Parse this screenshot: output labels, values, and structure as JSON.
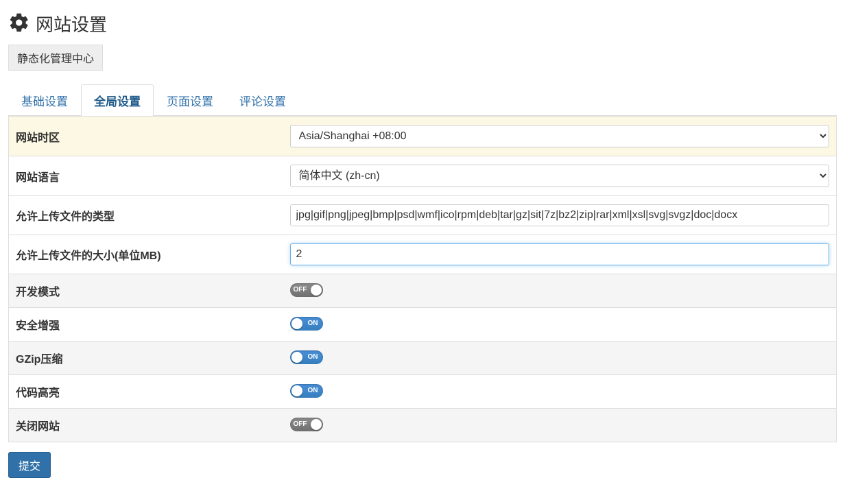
{
  "header": {
    "title": "网站设置",
    "subnav": "静态化管理中心"
  },
  "tabs": {
    "basic": "基础设置",
    "global": "全局设置",
    "page": "页面设置",
    "comment": "评论设置"
  },
  "rows": {
    "timezone": {
      "label": "网站时区",
      "value": "Asia/Shanghai +08:00"
    },
    "language": {
      "label": "网站语言",
      "value": "简体中文 (zh-cn)"
    },
    "upload_types": {
      "label": "允许上传文件的类型",
      "value": "jpg|gif|png|jpeg|bmp|psd|wmf|ico|rpm|deb|tar|gz|sit|7z|bz2|zip|rar|xml|xsl|svg|svgz|doc|docx"
    },
    "upload_size": {
      "label": "允许上传文件的大小(单位MB)",
      "value": "2"
    },
    "dev_mode": {
      "label": "开发模式",
      "state": "OFF"
    },
    "security": {
      "label": "安全增强",
      "state": "ON"
    },
    "gzip": {
      "label": "GZip压缩",
      "state": "ON"
    },
    "highlight": {
      "label": "代码高亮",
      "state": "ON"
    },
    "close_site": {
      "label": "关闭网站",
      "state": "OFF"
    }
  },
  "submit": "提交"
}
